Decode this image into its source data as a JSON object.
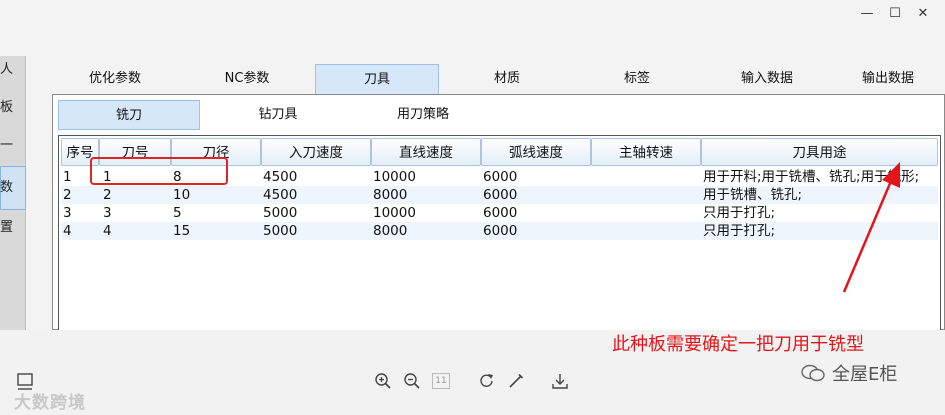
{
  "window": {
    "minimize_glyph": "—",
    "maximize_glyph": "☐",
    "close_glyph": "✕"
  },
  "left_strip": {
    "glyphs": [
      "人",
      "板",
      "一",
      "数",
      "置"
    ]
  },
  "top_tabs": [
    "优化参数",
    "NC参数",
    "刀具",
    "材质",
    "标签",
    "输入数据",
    "输出数据"
  ],
  "active_top_tab": "刀具",
  "sub_tabs": [
    "铣刀",
    "钻刀具",
    "用刀策略"
  ],
  "active_sub_tab": "铣刀",
  "table": {
    "columns": [
      "序号",
      "刀号",
      "刀径",
      "入刀速度",
      "直线速度",
      "弧线速度",
      "主轴转速",
      "刀具用途"
    ],
    "rows": [
      [
        "1",
        "1",
        "8",
        "4500",
        "10000",
        "6000",
        "",
        "用于开料;用于铣槽、铣孔;用于铣形;"
      ],
      [
        "2",
        "2",
        "10",
        "4500",
        "8000",
        "6000",
        "",
        "用于铣槽、铣孔;"
      ],
      [
        "3",
        "3",
        "5",
        "5000",
        "10000",
        "6000",
        "",
        "只用于打孔;"
      ],
      [
        "4",
        "4",
        "15",
        "5000",
        "8000",
        "6000",
        "",
        "只用于打孔;"
      ]
    ]
  },
  "annotation": "此种板需要确定一把刀用于铣型",
  "toolbar": {
    "page_count": "11"
  },
  "watermark_left": "大数跨境",
  "watermark_right": "全屋E柜",
  "colors": {
    "annotation_red": "#e3151a",
    "tab_active": "#d6e7f7",
    "header_border": "#aac6e2"
  }
}
